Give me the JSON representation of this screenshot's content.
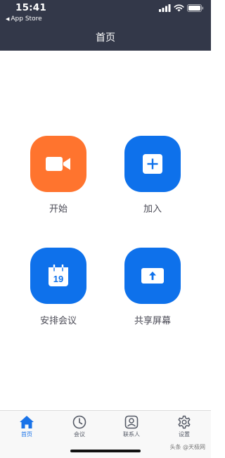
{
  "status_bar": {
    "time": "15:41",
    "back_app": "App Store"
  },
  "header": {
    "title": "首页"
  },
  "colors": {
    "header_bg": "#333849",
    "start_tile": "#FF742E",
    "blue_tile": "#0E71EB",
    "tab_active": "#1a73e8",
    "tab_inactive": "#555a66"
  },
  "actions": [
    {
      "label": "开始",
      "icon": "video-camera-icon"
    },
    {
      "label": "加入",
      "icon": "plus-icon"
    },
    {
      "label": "安排会议",
      "icon": "calendar-icon",
      "calendar_day": "19"
    },
    {
      "label": "共享屏幕",
      "icon": "share-screen-icon"
    }
  ],
  "tabbar": {
    "items": [
      {
        "label": "首页",
        "icon": "home-icon",
        "active": true
      },
      {
        "label": "会议",
        "icon": "clock-icon",
        "active": false
      },
      {
        "label": "联系人",
        "icon": "contact-icon",
        "active": false
      },
      {
        "label": "设置",
        "icon": "gear-icon",
        "active": false
      }
    ]
  },
  "watermark": "头条 @天极网"
}
